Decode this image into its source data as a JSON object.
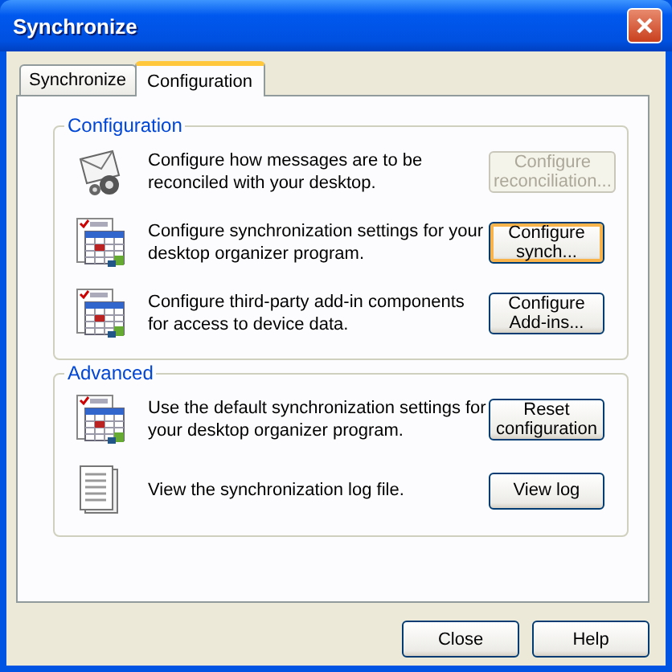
{
  "window": {
    "title": "Synchronize"
  },
  "tabs": [
    {
      "label": "Synchronize",
      "selected": false
    },
    {
      "label": "Configuration",
      "selected": true
    }
  ],
  "groups": [
    {
      "title": "Configuration",
      "rows": [
        {
          "kind": "mail",
          "text": "Configure how messages are to be reconciled with your desktop.",
          "button": {
            "label": "Configure reconciliation...",
            "disabled": true,
            "default": false
          }
        },
        {
          "kind": "calendar",
          "text": "Configure synchronization settings for your desktop organizer program.",
          "button": {
            "label": "Configure synch...",
            "disabled": false,
            "default": true
          }
        },
        {
          "kind": "calendar",
          "text": "Configure third-party add-in components for access to device data.",
          "button": {
            "label": "Configure Add-ins...",
            "disabled": false,
            "default": false
          }
        }
      ]
    },
    {
      "title": "Advanced",
      "rows": [
        {
          "kind": "calendar",
          "text": "Use the default synchronization settings for your desktop organizer program.",
          "button": {
            "label": "Reset configuration",
            "disabled": false,
            "default": false
          }
        },
        {
          "kind": "log",
          "text": "View the synchronization log file.",
          "button": {
            "label": "View log",
            "disabled": false,
            "default": false
          }
        }
      ]
    }
  ],
  "buttons": [
    {
      "label": "Close"
    },
    {
      "label": "Help"
    }
  ]
}
